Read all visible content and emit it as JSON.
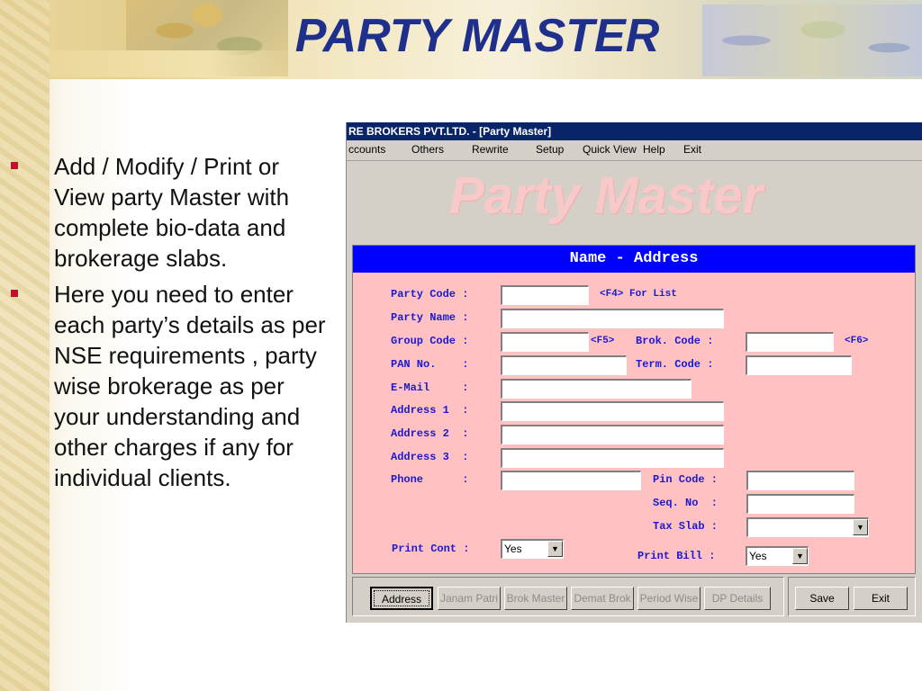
{
  "slide": {
    "title": "PARTY MASTER",
    "bullets": [
      "Add / Modify / Print or View party Master with complete bio-data and brokerage slabs.",
      "Here you need to enter each party’s details as per NSE requirements , party wise brokerage as per your understanding and other charges if any for individual clients."
    ]
  },
  "window": {
    "title": "RE BROKERS PVT.LTD. - [Party Master]",
    "watermark": "Party Master",
    "menu": [
      "ccounts",
      "Others",
      "Rewrite",
      "Setup",
      "Quick View",
      "Help",
      "Exit"
    ]
  },
  "form": {
    "section_title": "Name - Address",
    "labels": {
      "party_code": "Party Code :",
      "party_name": "Party Name :",
      "group_code": "Group Code :",
      "brok_code": "Brok. Code :",
      "pan_no": "PAN No.    :",
      "term_code": "Term. Code :",
      "email": "E-Mail     :",
      "address1": "Address 1  :",
      "address2": "Address 2  :",
      "address3": "Address 3  :",
      "phone": "Phone      :",
      "pin_code": "Pin Code :",
      "seq_no": "Seq. No  :",
      "tax_slab": "Tax Slab :",
      "print_cont": "Print Cont :",
      "print_bill": "Print Bill :"
    },
    "hints": {
      "f4": "<F4> For List",
      "f5": "<F5>",
      "f6": "<F6>"
    },
    "values": {
      "print_cont": "Yes",
      "print_bill": "Yes",
      "tax_slab": ""
    }
  },
  "buttons": {
    "tabs": [
      "Address",
      "Janam Patri",
      "Brok Master",
      "Demat Brok",
      "Period Wise",
      "DP Details"
    ],
    "save": "Save",
    "exit": "Exit"
  }
}
